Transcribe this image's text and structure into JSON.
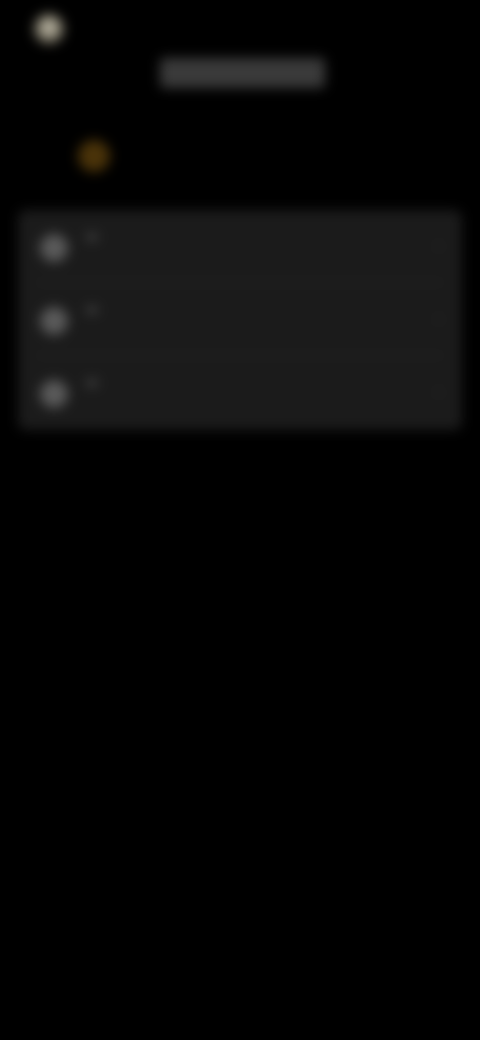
{
  "app": {
    "name": "",
    "page_title": ""
  },
  "chips": [
    {
      "label": ""
    },
    {
      "label": ""
    },
    {
      "label": ""
    },
    {
      "label": ""
    },
    {
      "label": ""
    },
    {
      "label": ""
    }
  ],
  "list": {
    "items": [
      {
        "label": "",
        "icon": "settings-icon"
      },
      {
        "label": "",
        "icon": "settings-icon"
      },
      {
        "label": "",
        "icon": "settings-icon"
      }
    ]
  },
  "colors": {
    "background": "#000000",
    "card": "#1b1b1b",
    "accent": "#b8860b"
  }
}
